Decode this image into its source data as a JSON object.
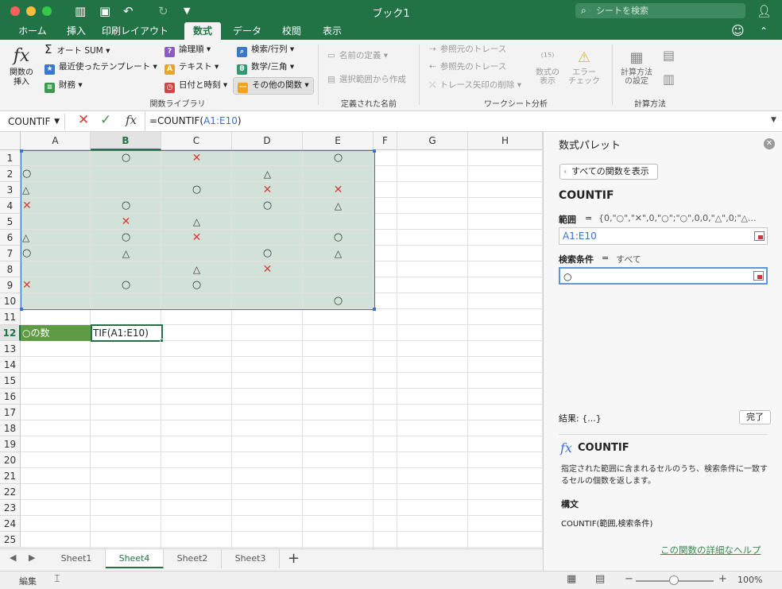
{
  "titlebar": {
    "title": "ブック1",
    "search_placeholder": "シートを検索"
  },
  "ribbon_tabs": [
    "ホーム",
    "挿入",
    "印刷レイアウト",
    "数式",
    "データ",
    "校閲",
    "表示"
  ],
  "active_tab": "数式",
  "ribbon": {
    "insert_function": [
      "関数の",
      "挿入"
    ],
    "fx_glyph": "fx",
    "col1": [
      "オート SUM",
      "最近使ったテンプレート",
      "財務"
    ],
    "col2": [
      "論理順",
      "テキスト",
      "日付と時刻"
    ],
    "col3": [
      "検索/行列",
      "数学/三角",
      "その他の関数"
    ],
    "group_function_library": "関数ライブラリ",
    "names": [
      "名前の定義",
      "選択範囲から作成"
    ],
    "group_defined_names": "定義された名前",
    "audit": [
      "参照元のトレース",
      "参照先のトレース",
      "トレース矢印の削除"
    ],
    "show_formula": [
      "数式の",
      "表示"
    ],
    "error_check": [
      "エラー",
      "チェック"
    ],
    "group_audit": "ワークシート分析",
    "calc_options": [
      "計算方法",
      "の設定"
    ],
    "group_calc": "計算方法"
  },
  "formula_bar": {
    "name_box": "COUNTIF",
    "formula_prefix": "=COUNTIF(",
    "formula_ref": "A1:E10",
    "formula_suffix": ")",
    "fx_label": "fx"
  },
  "columns": [
    "A",
    "B",
    "C",
    "D",
    "E",
    "F",
    "G",
    "H"
  ],
  "selected_column": "B",
  "selected_row": "12",
  "rows": [
    "1",
    "2",
    "3",
    "4",
    "5",
    "6",
    "7",
    "8",
    "9",
    "10",
    "11",
    "12",
    "13",
    "14",
    "15",
    "16",
    "17",
    "18",
    "19",
    "20",
    "21",
    "22",
    "23",
    "24",
    "25"
  ],
  "cells": [
    [
      "",
      "○",
      "✕",
      "",
      "○"
    ],
    [
      "○",
      "",
      "",
      "△",
      ""
    ],
    [
      "△",
      "",
      "○",
      "✕",
      "✕"
    ],
    [
      "✕",
      "○",
      "",
      "○",
      "△"
    ],
    [
      "",
      "✕",
      "△",
      "",
      ""
    ],
    [
      "△",
      "○",
      "✕",
      "",
      "○"
    ],
    [
      "○",
      "△",
      "",
      "○",
      "△"
    ],
    [
      "",
      "",
      "△",
      "✕",
      ""
    ],
    [
      "✕",
      "○",
      "○",
      "",
      ""
    ],
    [
      "",
      "",
      "",
      "",
      "○"
    ]
  ],
  "label_cell": "○の数",
  "edit_cell": "TIF(A1:E10)",
  "sheet_tabs": [
    "Sheet1",
    "Sheet4",
    "Sheet2",
    "Sheet3"
  ],
  "active_sheet": "Sheet4",
  "add_sheet": "+",
  "status": {
    "mode": "編集",
    "zoom": "100%"
  },
  "palette": {
    "title": "数式パレット",
    "back_button": "すべての関数を表示",
    "function_name": "COUNTIF",
    "arg1_label": "範囲",
    "arg1_eq": "=",
    "arg1_preview": "{0,\"○\",\"✕\",0,\"○\";\"○\",0,0,\"△\",0;\"△...",
    "arg1_value": "A1:E10",
    "arg2_label": "検索条件",
    "arg2_eq": "=",
    "arg2_preview": "すべて",
    "arg2_value": "○",
    "result": "結果: {...}",
    "done_button": "完了",
    "fx_glyph": "fx",
    "desc_function": "COUNTIF",
    "description": "指定された範囲に含まれるセルのうち、検索条件に一致するセルの個数を返します。",
    "syntax_heading": "構文",
    "syntax": "COUNTIF(範囲,検索条件)",
    "help_link": "この関数の詳細なヘルプ"
  },
  "colors": {
    "brand_green": "#217346",
    "selection_fill": "#d3e2d9",
    "cross_red": "#d43c3c"
  }
}
